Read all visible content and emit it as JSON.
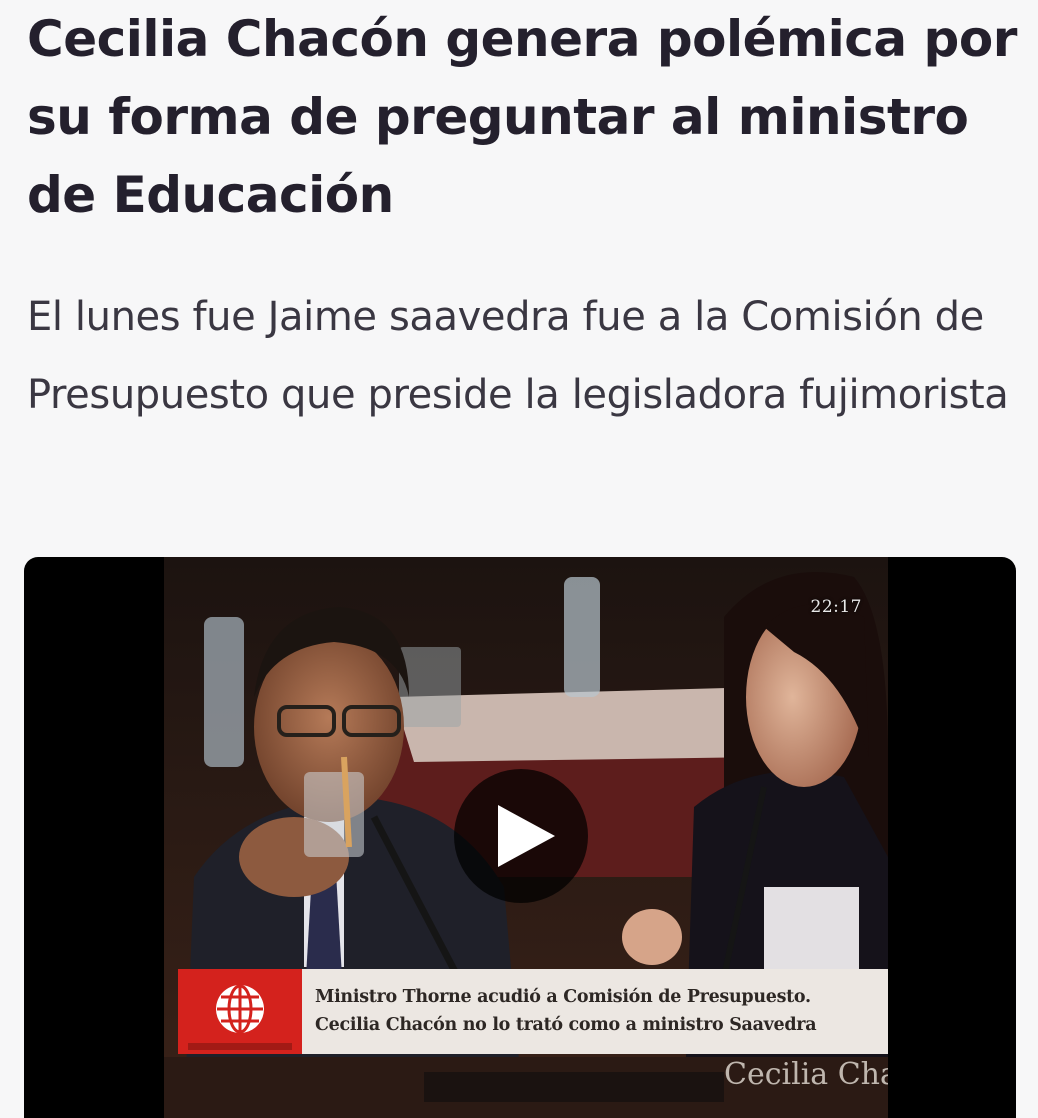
{
  "article": {
    "headline": "Cecilia Chacón genera polémica por su forma de preguntar al ministro de Educación",
    "summary": "El lunes fue Jaime saavedra fue a la Comisión de Presupuesto que preside la legisladora fujimorista"
  },
  "video": {
    "timestamp": "22:17",
    "caption_line_1": "Ministro Thorne acudió a Comisión de Presupuesto.",
    "caption_line_2": "Cecilia Chacón no lo trató como a ministro Saavedra",
    "nameplate": "Cecilia Chacón",
    "play_icon": "play-icon",
    "logo_icon": "globe-logo-icon"
  }
}
